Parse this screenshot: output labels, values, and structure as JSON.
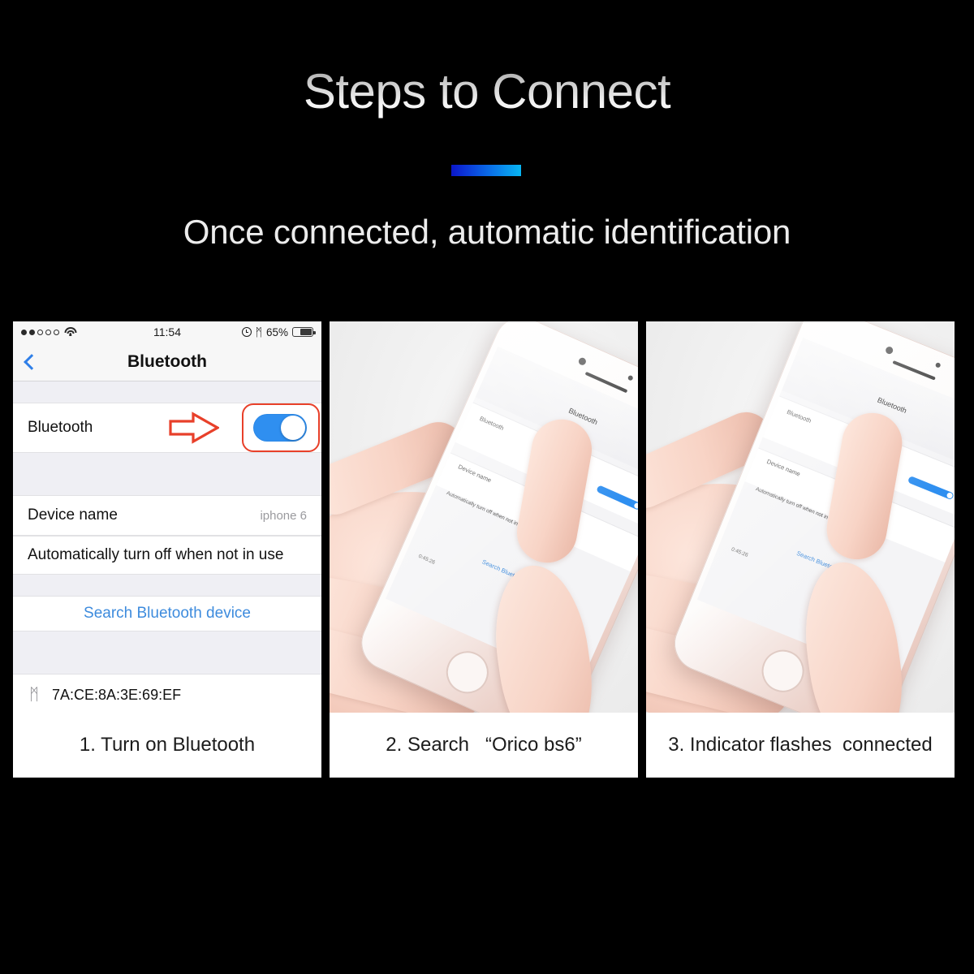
{
  "header": {
    "title": "Steps to Connect",
    "subtitle": "Once connected, automatic identification",
    "accent_gradient_from": "#0b17c9",
    "accent_gradient_to": "#08b6f2"
  },
  "panels": [
    {
      "caption": "1. Turn on Bluetooth",
      "type": "screenshot",
      "phone": {
        "status_bar": {
          "signal_filled": 2,
          "signal_total": 5,
          "wifi_icon": "wifi-icon",
          "time": "11:54",
          "alarm_icon": "alarm-clock-icon",
          "bluetooth_icon": "ᛗ",
          "battery_percent": "65%",
          "battery_level": 65
        },
        "nav": {
          "back_icon": "chevron-left-icon",
          "title": "Bluetooth"
        },
        "rows": {
          "bluetooth_label": "Bluetooth",
          "bluetooth_toggle_on": true,
          "device_name_label": "Device name",
          "device_name_value": "iphone 6",
          "auto_off_label": "Automatically turn off when not in use",
          "search_label": "Search Bluetooth device",
          "found_device_mac": "7A:CE:8A:3E:69:EF",
          "found_device_icon": "bluetooth-icon"
        },
        "annotation": {
          "arrow_icon": "right-arrow-annotation",
          "highlight_color": "#e8402a"
        }
      }
    },
    {
      "caption": "2. Search   “Orico bs6”",
      "type": "photo",
      "photo": {
        "description": "hand-holding-iphone",
        "mini_screen": {
          "title": "Bluetooth",
          "bluetooth_label": "Bluetooth",
          "device_name_label": "Device name",
          "auto_off_label": "Automatically turn off when not in use",
          "search_label": "Search Bluetooth device",
          "mac": "0:45:26"
        }
      }
    },
    {
      "caption": "3. Indicator flashes  connected",
      "type": "photo",
      "photo": {
        "description": "hand-holding-iphone-connected",
        "mini_screen": {
          "title": "Bluetooth",
          "bluetooth_label": "Bluetooth",
          "device_name_label": "Device name",
          "auto_off_label": "Automatically turn off when not in use",
          "search_label": "Search Bluetooth device",
          "mac": "0:45:26",
          "spinner_icon": "connecting-spinner-icon"
        }
      }
    }
  ]
}
